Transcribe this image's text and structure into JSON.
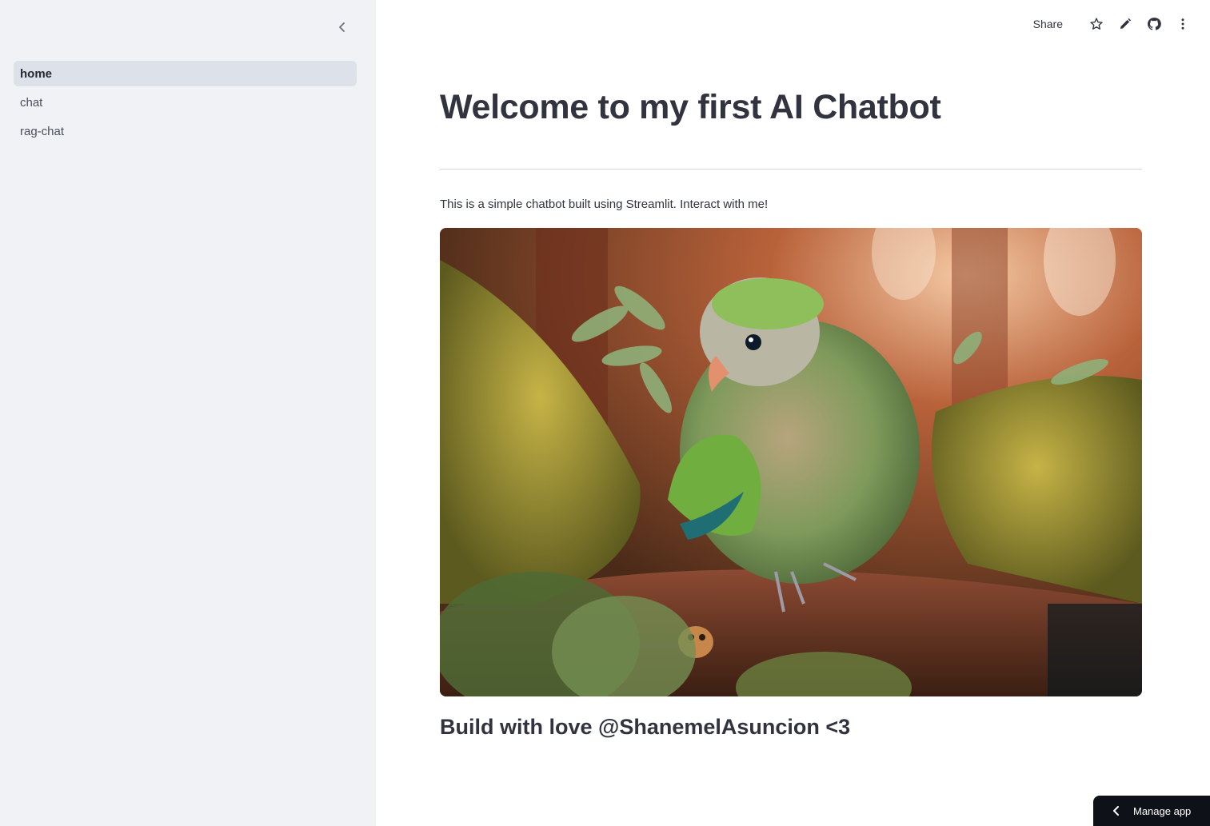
{
  "sidebar": {
    "items": [
      {
        "label": "home",
        "active": true
      },
      {
        "label": "chat",
        "active": false
      },
      {
        "label": "rag-chat",
        "active": false
      }
    ]
  },
  "toolbar": {
    "share_label": "Share",
    "icons": [
      "star-icon",
      "pencil-icon",
      "github-icon",
      "more-vertical-icon"
    ]
  },
  "main": {
    "title": "Welcome to my first AI Chatbot",
    "intro": "This is a simple chatbot built using Streamlit. Interact with me!",
    "footer_note": "Build with love @ShanemelAsuncion <3"
  },
  "manage_app": {
    "label": "Manage app"
  },
  "colors": {
    "sidebar_bg": "#F0F2F6",
    "active_item_bg": "#DDE2EA",
    "text": "#31333F",
    "manage_bg": "#0e1117"
  }
}
